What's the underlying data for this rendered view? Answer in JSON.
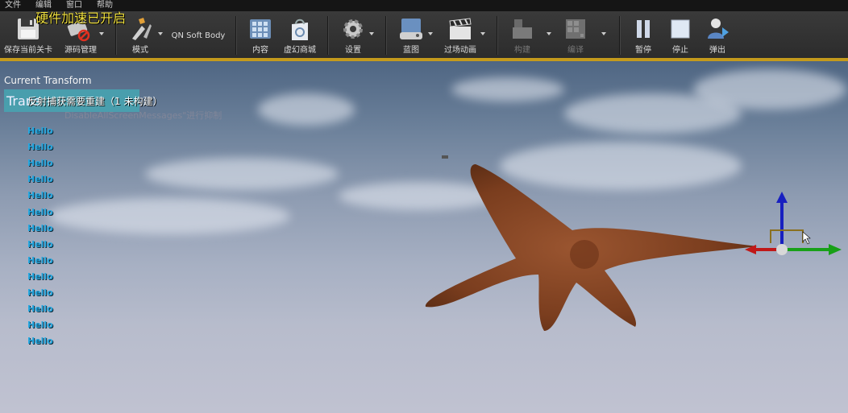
{
  "menu": [
    "文件",
    "编辑",
    "窗口",
    "帮助"
  ],
  "overlay": {
    "hw_accel": "硬件加速已开启"
  },
  "toolbar": {
    "save": "保存当前关卡",
    "source_control": "源码管理",
    "modes": "模式",
    "plugin": "QN Soft Body",
    "content": "内容",
    "marketplace": "虚幻商城",
    "settings": "设置",
    "blueprints": "蓝图",
    "cinematics": "过场动画",
    "build": "构建",
    "compile": "编译",
    "pause": "暂停",
    "stop": "停止",
    "eject": "弹出"
  },
  "viewport": {
    "title": "Current Transform",
    "tab_text": "Trans",
    "rebuild_notice": "反射捕获需要重建（1 未构建）",
    "disable_msg": "DisableAllScreenMessages\"进行抑制",
    "hello_lines": [
      "Hello",
      "Hello",
      "Hello",
      "Hello",
      "Hello",
      "Hello",
      "Hello",
      "Hello",
      "Hello",
      "Hello",
      "Hello",
      "Hello",
      "Hello",
      "Hello",
      "Hello"
    ]
  }
}
